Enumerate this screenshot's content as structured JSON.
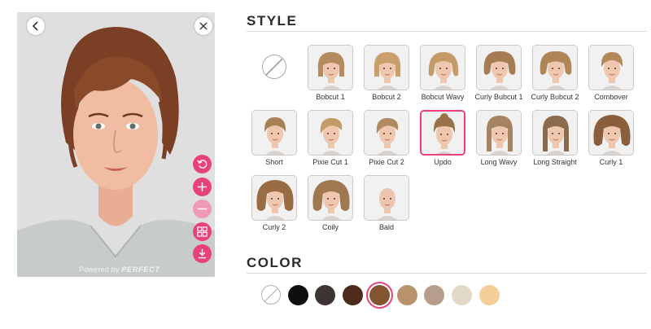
{
  "photo": {
    "powered_prefix": "Powered by",
    "powered_brand": "PERFECT"
  },
  "style": {
    "title": "STYLE",
    "items": [
      {
        "label": "Bobcut 1",
        "hair": "#b58a5e",
        "shape": "bob"
      },
      {
        "label": "Bobcut 2",
        "hair": "#c9a06c",
        "shape": "bob"
      },
      {
        "label": "Bobcut Wavy",
        "hair": "#c49a66",
        "shape": "wavy"
      },
      {
        "label": "Curly Bubcut 1",
        "hair": "#a57c52",
        "shape": "curlybob"
      },
      {
        "label": "Curly Bubcut 2",
        "hair": "#b08656",
        "shape": "curlybob"
      },
      {
        "label": "Combover",
        "hair": "#b4895a",
        "shape": "short"
      },
      {
        "label": "Short",
        "hair": "#a78055",
        "shape": "short"
      },
      {
        "label": "Pixie Cut 1",
        "hair": "#c39a68",
        "shape": "pixie"
      },
      {
        "label": "Pixie Cut 2",
        "hair": "#b08a60",
        "shape": "pixie"
      },
      {
        "label": "Updo",
        "hair": "#9a7048",
        "shape": "updo",
        "selected": true
      },
      {
        "label": "Long Wavy",
        "hair": "#a68462",
        "shape": "long"
      },
      {
        "label": "Long Straight",
        "hair": "#8c6a4c",
        "shape": "long"
      },
      {
        "label": "Curly 1",
        "hair": "#8a5e3a",
        "shape": "curly"
      },
      {
        "label": "Curly 2",
        "hair": "#9a6c44",
        "shape": "curly"
      },
      {
        "label": "Coily",
        "hair": "#a07850",
        "shape": "curly"
      },
      {
        "label": "Bald",
        "hair": "#e6c4b0",
        "shape": "bald"
      }
    ]
  },
  "color": {
    "title": "COLOR",
    "swatches": [
      {
        "name": "black",
        "hex": "#0f0f10"
      },
      {
        "name": "dark-brown",
        "hex": "#3e3434"
      },
      {
        "name": "brown",
        "hex": "#4d2a1c"
      },
      {
        "name": "chestnut",
        "hex": "#83552f",
        "selected": true
      },
      {
        "name": "light-brown",
        "hex": "#b8926b"
      },
      {
        "name": "ash",
        "hex": "#b79e8c"
      },
      {
        "name": "platinum",
        "hex": "#e2d9c8"
      },
      {
        "name": "honey-blonde",
        "hex": "#f4cf9a"
      }
    ]
  },
  "icons": {
    "back": "chevron-left-icon",
    "close": "close-icon",
    "tools": [
      "reset-icon",
      "zoom-in-icon",
      "zoom-out-icon",
      "compare-icon",
      "download-icon"
    ]
  },
  "accent": "#e8417b"
}
